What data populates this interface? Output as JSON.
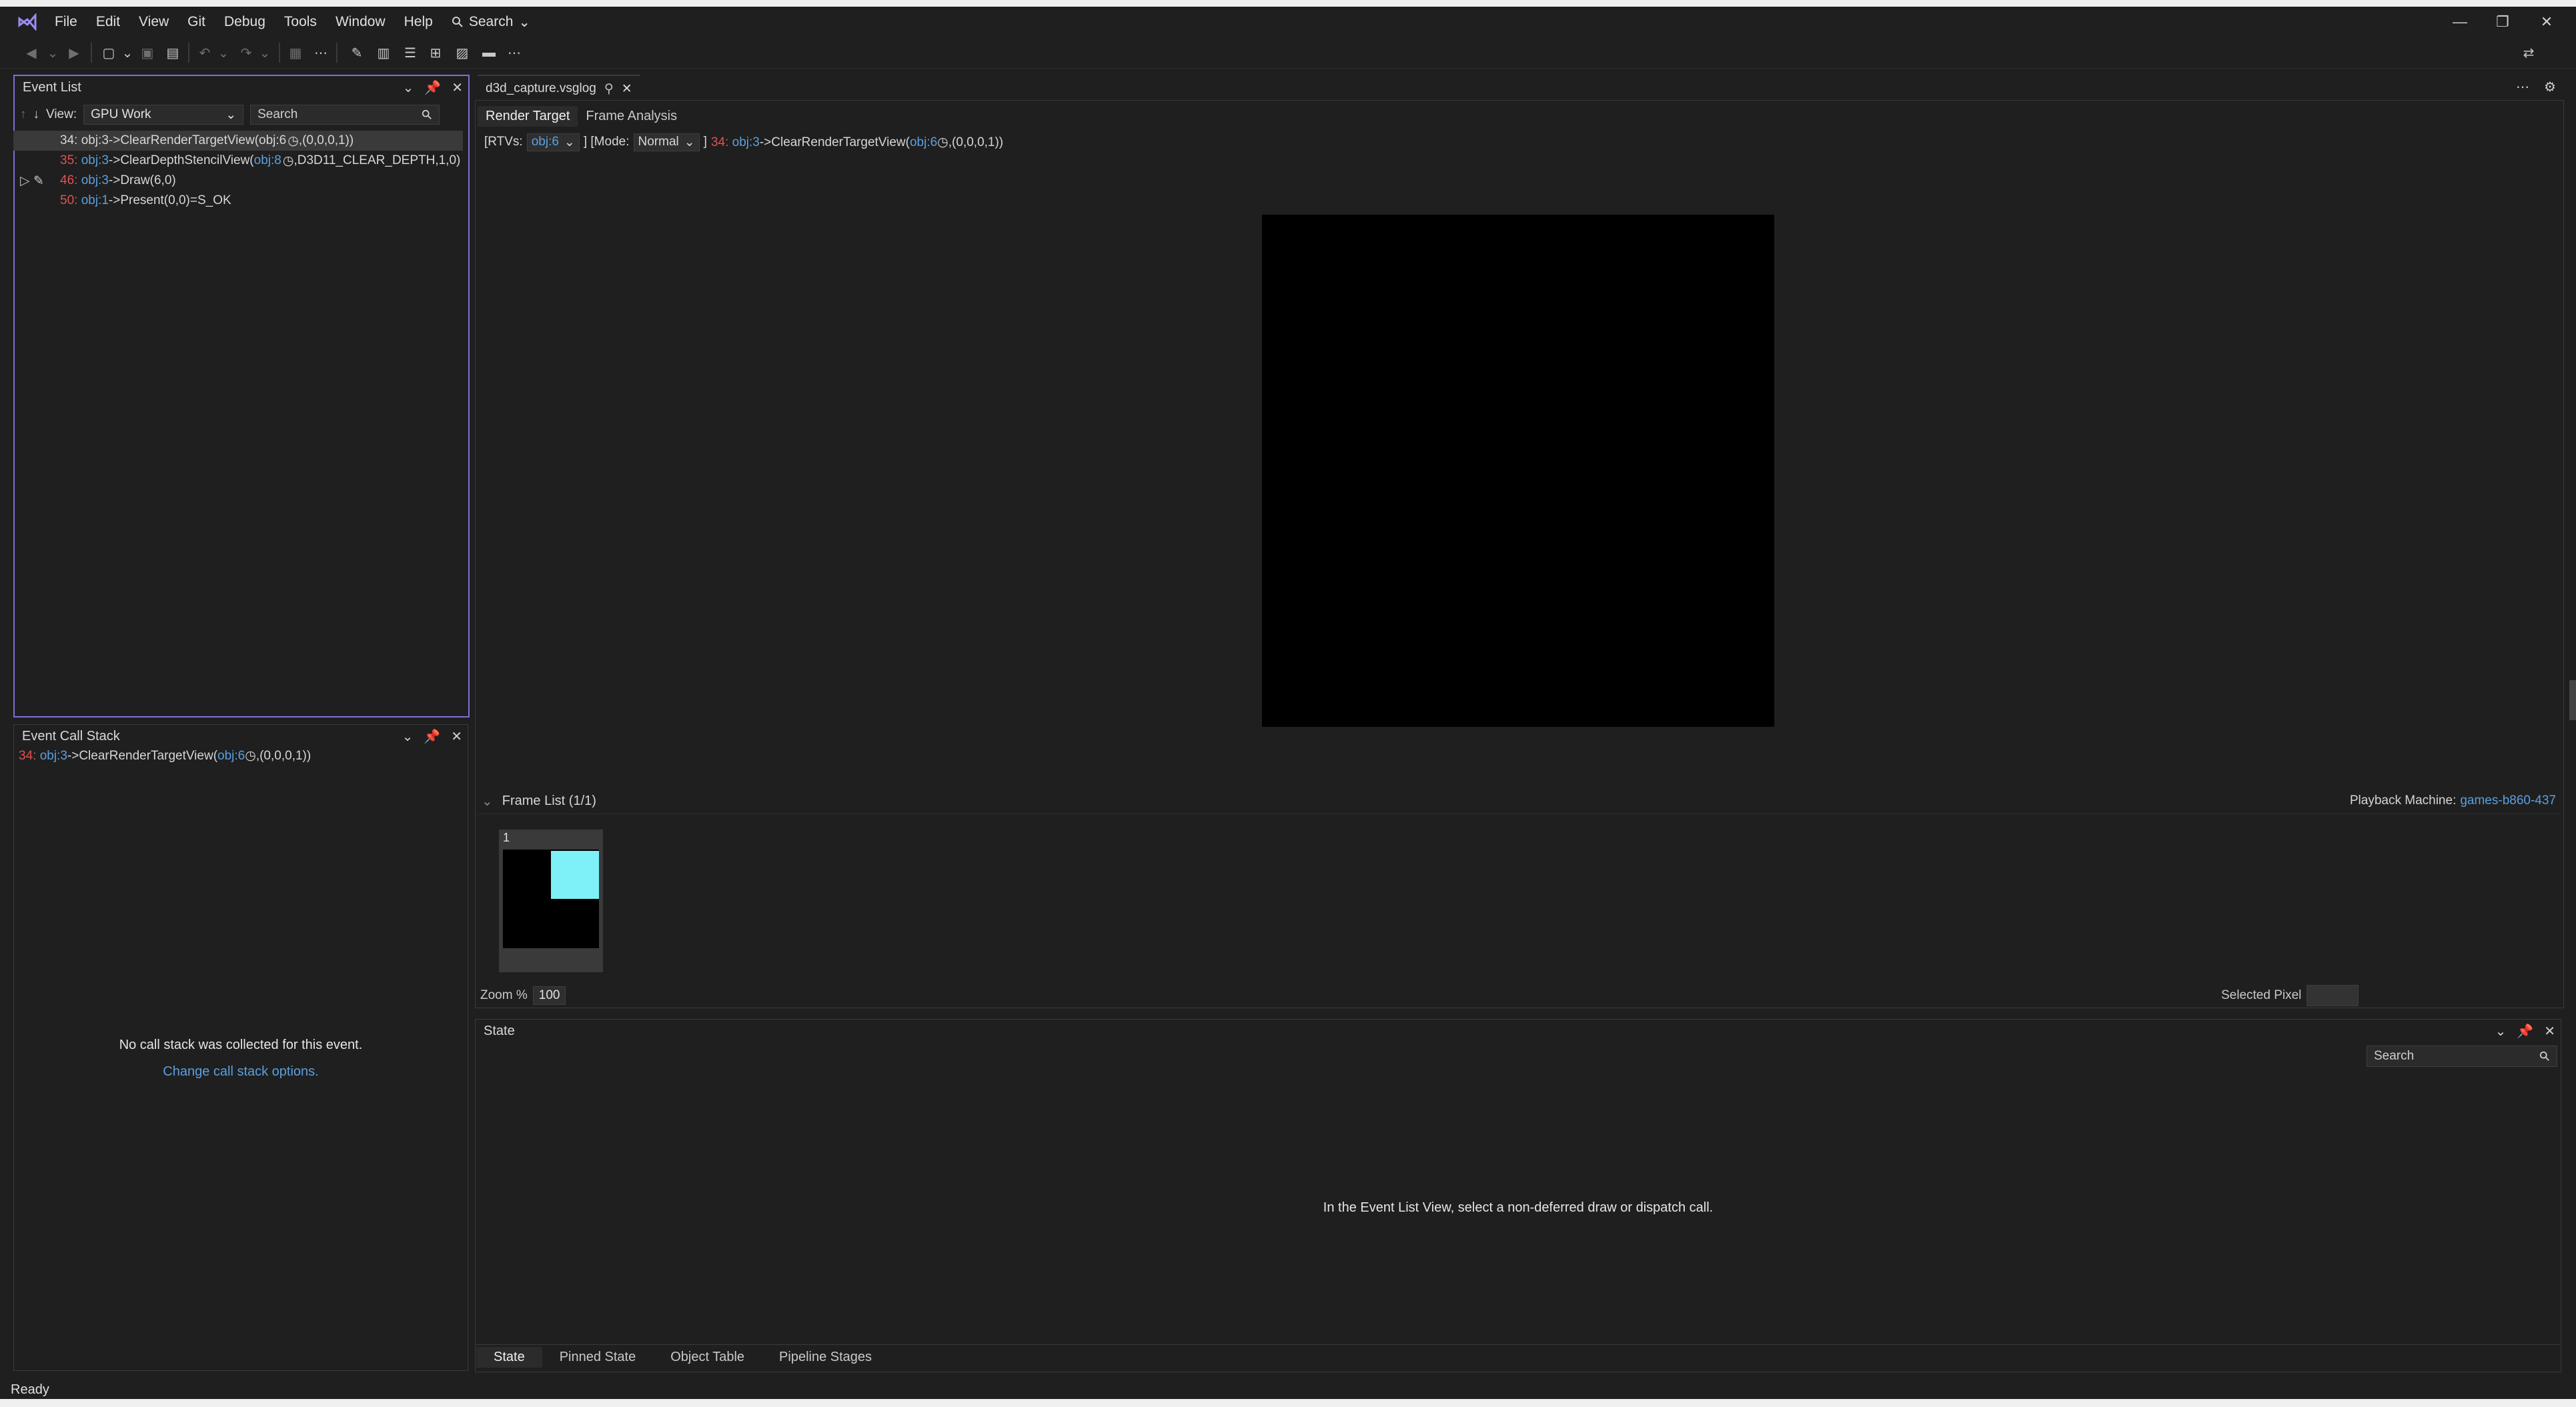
{
  "menu": {
    "items": [
      "File",
      "Edit",
      "View",
      "Git",
      "Debug",
      "Tools",
      "Window",
      "Help"
    ],
    "search_label": "Search"
  },
  "event_list": {
    "title": "Event List",
    "view_label": "View:",
    "view_value": "GPU Work",
    "search_placeholder": "Search",
    "rows": [
      {
        "num": "34:",
        "obj": "obj:3",
        "call": "->ClearRenderTargetView(",
        "arg_obj": "obj:6",
        "rest": ",(0,0,0,1))",
        "selected": true
      },
      {
        "num": "35:",
        "obj": "obj:3",
        "call": "->ClearDepthStencilView(",
        "arg_obj": "obj:8",
        "rest": ",D3D11_CLEAR_DEPTH,1,0)",
        "selected": false
      },
      {
        "num": "46:",
        "obj": "obj:3",
        "call": "->Draw(6,0)",
        "arg_obj": "",
        "rest": "",
        "selected": false
      },
      {
        "num": "50:",
        "obj": "obj:1",
        "call": "->Present(0,0)=S_OK",
        "arg_obj": "",
        "rest": "",
        "selected": false
      }
    ]
  },
  "call_stack": {
    "title": "Event Call Stack",
    "line": {
      "num": "34:",
      "obj": "obj:3",
      "call": "->ClearRenderTargetView(",
      "arg_obj": "obj:6",
      "rest": ",(0,0,0,1))"
    },
    "message": "No call stack was collected for this event.",
    "link": "Change call stack options."
  },
  "document": {
    "tab_title": "d3d_capture.vsglog",
    "subtabs": [
      "Render Target",
      "Frame Analysis"
    ],
    "rtv": {
      "prefix": "[RTVs:",
      "rtv_value": "obj:6",
      "mode_prefix": "] [Mode:",
      "mode_value": "Normal",
      "suffix": "]",
      "event_num": "34:",
      "event_obj": "obj:3",
      "event_call": "->ClearRenderTargetView(",
      "event_arg": "obj:6",
      "event_rest": ",(0,0,0,1))"
    },
    "frame_list_label": "Frame List (1/1)",
    "playback_label": "Playback Machine:",
    "playback_machine": "games-b860-437",
    "frame_number": "1",
    "zoom_label": "Zoom %",
    "zoom_value": "100",
    "selected_pixel_label": "Selected Pixel"
  },
  "state": {
    "title": "State",
    "search_placeholder": "Search",
    "message": "In the Event List View, select a non-deferred draw or dispatch call.",
    "tabs": [
      "State",
      "Pinned State",
      "Object Table",
      "Pipeline Stages"
    ]
  },
  "status": {
    "text": "Ready"
  },
  "colors": {
    "accent": "#7f6fd6",
    "event_number": "#e05252",
    "object_link": "#5aa0e0",
    "thumbnail_cyan": "#7ef0f8"
  }
}
